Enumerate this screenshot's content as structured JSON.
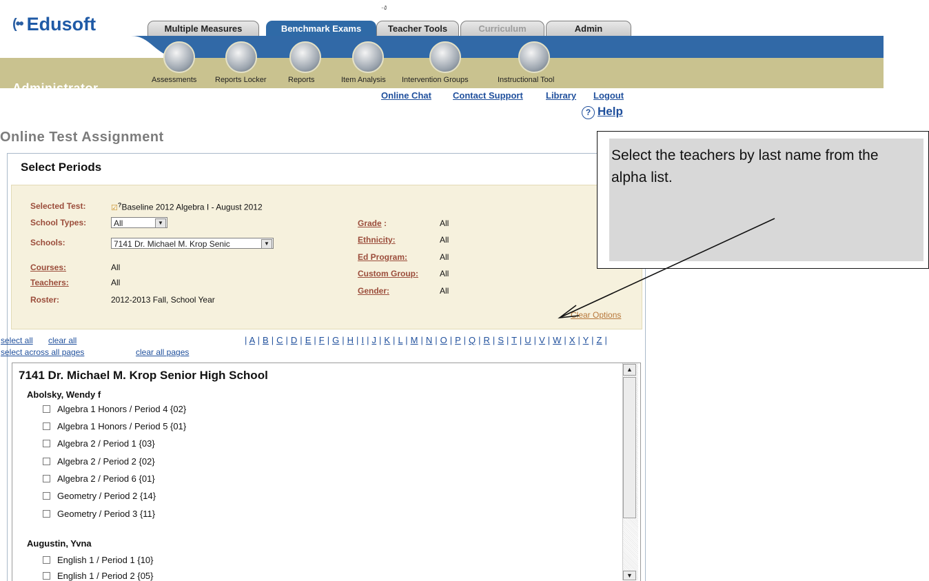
{
  "header": {
    "brand": "Edusoft",
    "role": "Administrator",
    "tabs": [
      {
        "label": "Multiple Measures"
      },
      {
        "label": "Benchmark Exams"
      },
      {
        "label": "Teacher Tools"
      },
      {
        "label": "Curriculum"
      },
      {
        "label": "Admin"
      }
    ],
    "nav": [
      {
        "label": "Assessments",
        "icon": "assessments-icon"
      },
      {
        "label": "Reports Locker",
        "icon": "reports-locker-icon"
      },
      {
        "label": "Reports",
        "icon": "reports-icon"
      },
      {
        "label": "Item Analysis",
        "icon": "item-analysis-icon"
      },
      {
        "label": "Intervention Groups",
        "icon": "intervention-groups-icon"
      },
      {
        "label": "Instructional Tool",
        "icon": "instructional-tool-icon"
      }
    ],
    "links": {
      "online_chat": "Online Chat",
      "contact_support": "Contact Support",
      "library": "Library",
      "logout": "Logout",
      "help": "Help"
    }
  },
  "page_title": "Online Test Assignment",
  "panel": {
    "title": "Select Periods",
    "filters": {
      "selected_test_label": "Selected Test:",
      "selected_test_value": "Baseline 2012 Algebra I - August 2012",
      "school_types_label": "School Types:",
      "school_types_value": "All",
      "schools_label": "Schools:",
      "schools_value": "7141 Dr. Michael M. Krop Senic",
      "courses_label": "Courses:",
      "courses_value": "All",
      "teachers_label": "Teachers:",
      "teachers_value": "All",
      "roster_label": "Roster:",
      "roster_value": "2012-2013 Fall, School Year",
      "grade_label": "Grade",
      "grade_value": "All",
      "ethnicity_label": "Ethnicity:",
      "ethnicity_value": "All",
      "ed_program_label": "Ed Program:",
      "ed_program_value": "All",
      "custom_group_label": "Custom Group:",
      "custom_group_value": "All",
      "gender_label": "Gender:",
      "gender_value": "All",
      "clear_options": "Clear Options"
    },
    "selection": {
      "select_all": "select all",
      "clear_all": "clear all",
      "select_across": "select across all pages",
      "clear_all_pages": "clear all pages"
    },
    "alpha": [
      "A",
      "B",
      "C",
      "D",
      "E",
      "F",
      "G",
      "H",
      "I",
      "J",
      "K",
      "L",
      "M",
      "N",
      "O",
      "P",
      "Q",
      "R",
      "S",
      "T",
      "U",
      "V",
      "W",
      "X",
      "Y",
      "Z"
    ],
    "school_name": "7141 Dr. Michael M. Krop Senior High School",
    "teachers": [
      {
        "name": "Abolsky, Wendy f",
        "periods": [
          "Algebra 1 Honors / Period 4 {02}",
          "Algebra 1 Honors / Period 5 {01}",
          "Algebra 2 / Period 1 {03}",
          "Algebra 2 / Period 2 {02}",
          "Algebra 2 / Period 6 {01}",
          "Geometry / Period 2 {14}",
          "Geometry / Period 3 {11}"
        ]
      },
      {
        "name": "Augustin, Yvna",
        "periods": [
          "English 1 / Period 1 {10}",
          "English 1 / Period 2 {05}"
        ]
      }
    ]
  },
  "callout": {
    "text": "Select the teachers by last name from the alpha list."
  }
}
